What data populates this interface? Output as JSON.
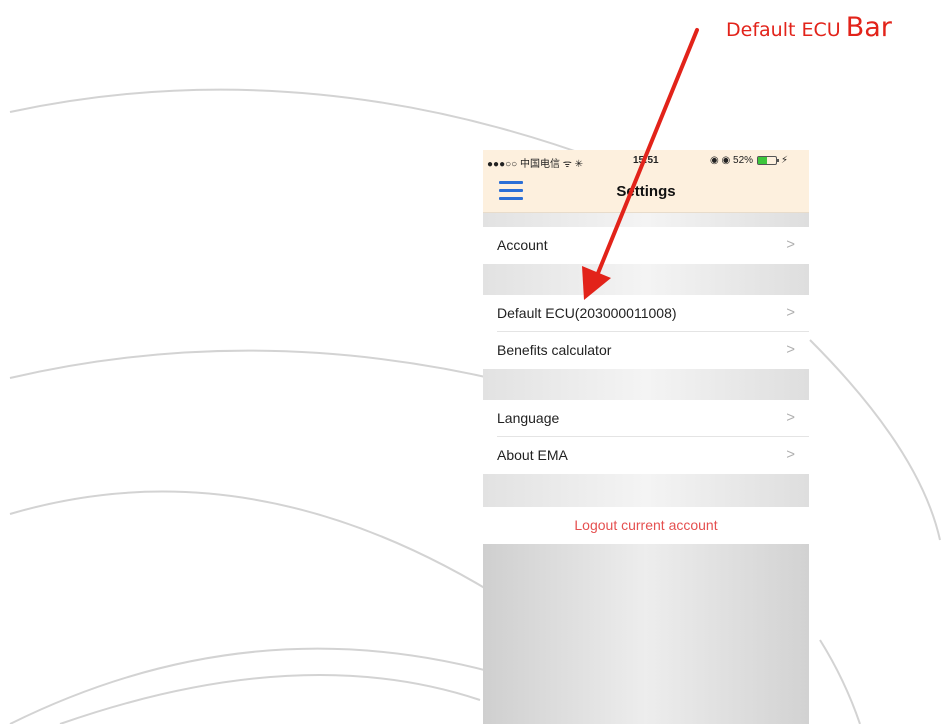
{
  "annotation": {
    "label_small": "Default ECU",
    "label_big": "Bar",
    "color": "#e2231a"
  },
  "status_bar": {
    "carrier": "●●●○○ 中国电信 ᯤ ✳",
    "time": "15:51",
    "icons": "◉ ◉ 52%",
    "battery_level": 0.52
  },
  "nav": {
    "title": "Settings",
    "menu_icon": "hamburger-menu-icon"
  },
  "rows": {
    "account": "Account",
    "default_ecu": "Default ECU(203000011008)",
    "benefits": "Benefits calculator",
    "language": "Language",
    "about": "About EMA",
    "chevron": ">"
  },
  "logout": {
    "label": "Logout current account",
    "color": "#e55050"
  },
  "colors": {
    "nav_bg": "#fdf0de",
    "menu_icon": "#2b6fd6",
    "section_gap": "#e6e6e6"
  }
}
